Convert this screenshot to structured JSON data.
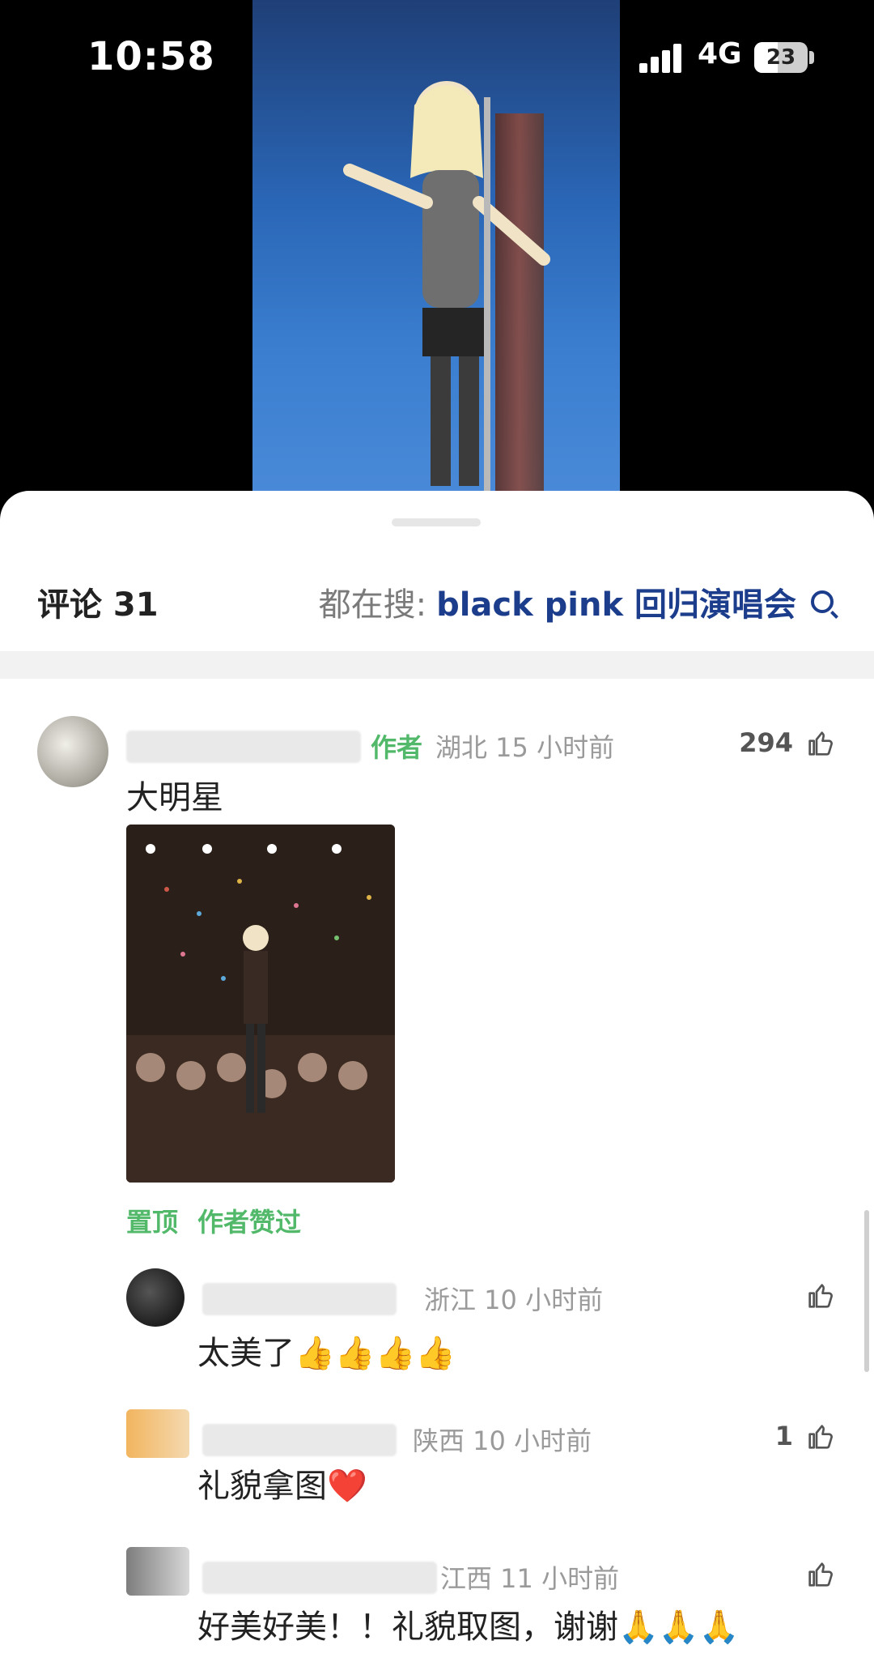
{
  "status_bar": {
    "time": "10:58",
    "network": "4G",
    "battery": "23"
  },
  "header": {
    "title": "评论 31",
    "search_prefix": "都在搜:",
    "search_term": "black pink 回归演唱会"
  },
  "comments": [
    {
      "author_tag": "作者",
      "location_time": "湖北 15 小时前",
      "likes": "294",
      "text": "大明星",
      "actions": [
        "置顶",
        "作者赞过"
      ]
    }
  ],
  "replies": [
    {
      "location_time": "浙江 10 小时前",
      "likes": "",
      "text": "太美了👍👍👍👍"
    },
    {
      "location_time": "陕西 10 小时前",
      "likes": "1",
      "text": "礼貌拿图❤️"
    },
    {
      "location_time": "江西 11 小时前",
      "likes": "",
      "text": "好美好美！！礼貌取图，谢谢🙏🙏🙏"
    }
  ]
}
